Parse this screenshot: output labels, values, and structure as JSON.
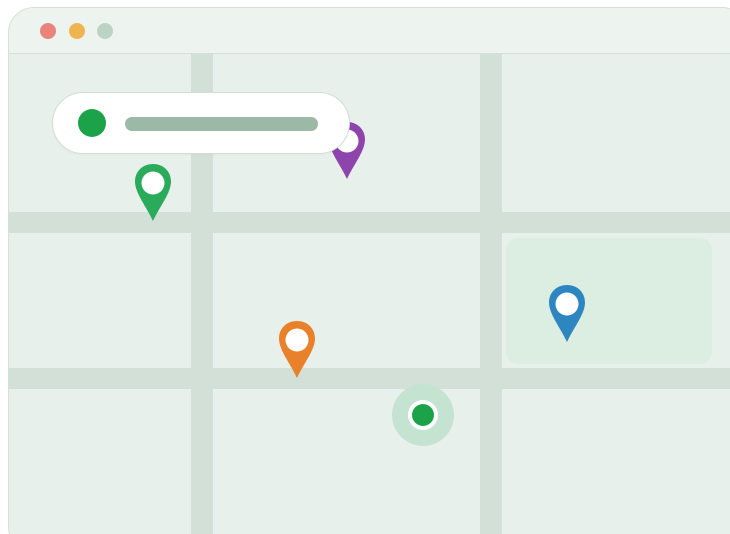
{
  "window": {
    "controls": [
      {
        "name": "close",
        "color": "#e8847c"
      },
      {
        "name": "minimize",
        "color": "#edb54f"
      },
      {
        "name": "zoom",
        "color": "#bcd3c4"
      }
    ]
  },
  "map": {
    "background_color": "#e8f0eb",
    "road_color": "#d3e0d8",
    "park_color": "#dcede1"
  },
  "search": {
    "indicator_color": "#1ca34a",
    "placeholder_bar_color": "#9cb8a6"
  },
  "markers": [
    {
      "name": "green-pin",
      "icon": "map-pin-icon",
      "color": "#2aab5b"
    },
    {
      "name": "purple-pin",
      "icon": "map-pin-icon",
      "color": "#8e44ad"
    },
    {
      "name": "orange-pin",
      "icon": "map-pin-icon",
      "color": "#e8812a"
    },
    {
      "name": "blue-pin",
      "icon": "map-pin-icon",
      "color": "#2e86c1"
    }
  ],
  "current_location": {
    "icon": "current-location-icon",
    "color": "#1ca34a",
    "halo_color": "#c5e3d1"
  }
}
